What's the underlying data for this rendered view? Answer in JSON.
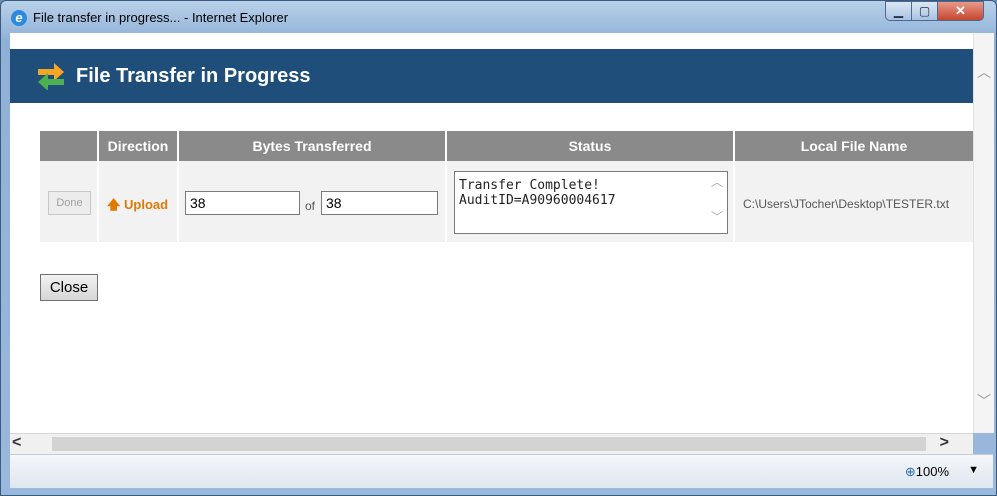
{
  "window": {
    "title": "File transfer in progress... - Internet Explorer"
  },
  "header": {
    "title": "File Transfer in Progress"
  },
  "table": {
    "columns": [
      "",
      "Direction",
      "Bytes Transferred",
      "Status",
      "Local File Name"
    ],
    "row": {
      "action_label": "Done",
      "direction": "Upload",
      "bytes_done": "38",
      "of_label": "of",
      "bytes_total": "38",
      "status": "Transfer Complete!\nAuditID=A90960004617",
      "local_file": "C:\\Users\\JTocher\\Desktop\\TESTER.txt"
    }
  },
  "close_label": "Close",
  "statusbar": {
    "zoom": "100%"
  },
  "icons": {
    "browser": "ie-icon",
    "transfer": "transfer-arrows-icon",
    "upload": "arrow-up-icon",
    "zoom": "zoom-icon"
  },
  "colors": {
    "header_band": "#1f4e7a",
    "table_header": "#8a8a8a",
    "upload": "#e07a00"
  }
}
